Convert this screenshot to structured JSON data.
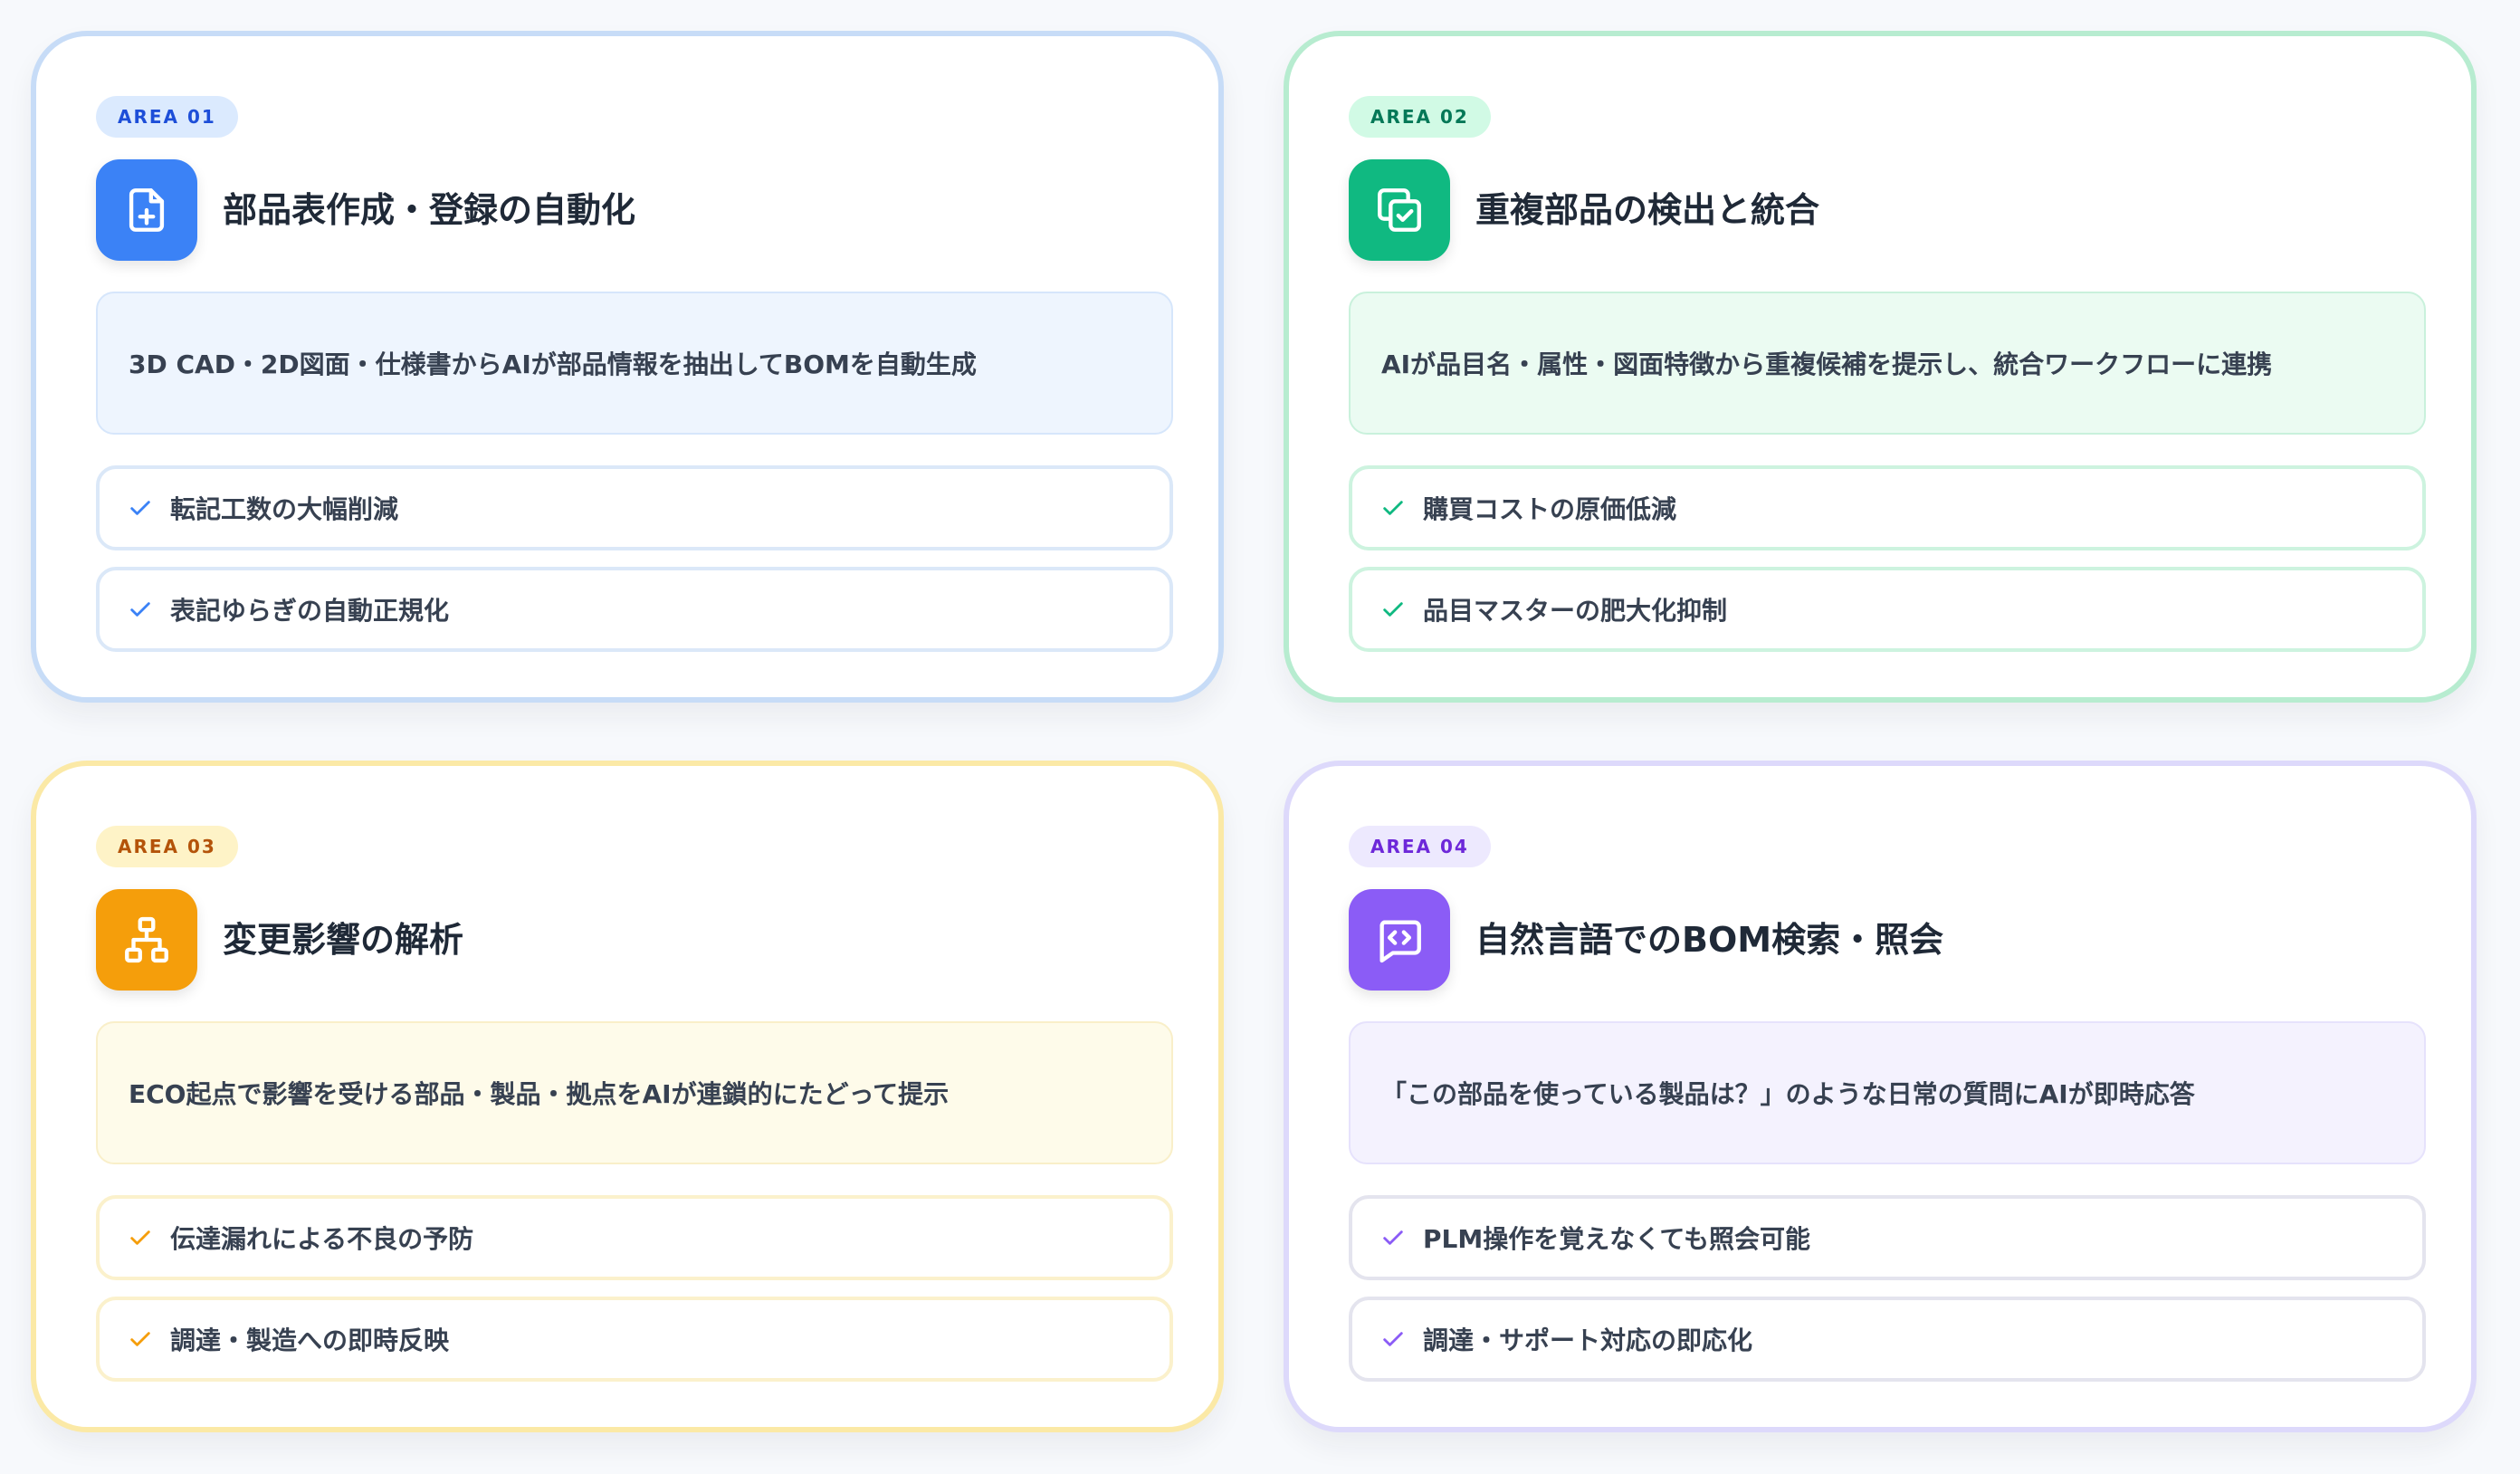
{
  "cards": [
    {
      "badge": "AREA 01",
      "icon": "file-plus-icon",
      "title": "部品表作成・登録の自動化",
      "description": "3D CAD・2D図面・仕様書からAIが部品情報を抽出してBOMを自動生成",
      "benefits": [
        "転記工数の大幅削減",
        "表記ゆらぎの自動正規化"
      ],
      "accent": "#3b82f6"
    },
    {
      "badge": "AREA 02",
      "icon": "copy-check-icon",
      "title": "重複部品の検出と統合",
      "description": "AIが品目名・属性・図面特徴から重複候補を提示し、統合ワークフローに連携",
      "benefits": [
        "購買コストの原価低減",
        "品目マスターの肥大化抑制"
      ],
      "accent": "#10b981"
    },
    {
      "badge": "AREA 03",
      "icon": "hierarchy-icon",
      "title": "変更影響の解析",
      "description": "ECO起点で影響を受ける部品・製品・拠点をAIが連鎖的にたどって提示",
      "benefits": [
        "伝達漏れによる不良の予防",
        "調達・製造への即時反映"
      ],
      "accent": "#f59e0b"
    },
    {
      "badge": "AREA 04",
      "icon": "chat-code-icon",
      "title": "自然言語でのBOM検索・照会",
      "description": "「この部品を使っている製品は？」のような日常の質問にAIが即時応答",
      "benefits": [
        "PLM操作を覚えなくても照会可能",
        "調達・サポート対応の即応化"
      ],
      "accent": "#8b5cf6"
    }
  ]
}
